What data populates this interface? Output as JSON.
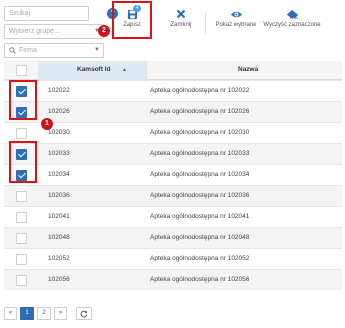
{
  "filters": {
    "search_placeholder": "Szukaj",
    "help_label": "?",
    "group_placeholder": "Wybierz grupę...",
    "firm_placeholder": "Firma"
  },
  "toolbar": {
    "save_label": "Zapisz",
    "save_badge": "4",
    "close_label": "Zamknij",
    "show_selected_label": "Pokaż wybrane",
    "clear_selected_label": "Wyczyść zaznaczone"
  },
  "markers": {
    "first": "1",
    "second": "2"
  },
  "table": {
    "columns": [
      {
        "label": "Kamsoft Id",
        "sort_indicator": "▲"
      },
      {
        "label": "Nazwa"
      }
    ],
    "rows": [
      {
        "id": "102022",
        "name": "Apteka ogólnodostępna nr 102022",
        "checked": true
      },
      {
        "id": "102026",
        "name": "Apteka ogólnodostępna nr 102026",
        "checked": true
      },
      {
        "id": "102030",
        "name": "Apteka ogólnodostępna nr 102030",
        "checked": false
      },
      {
        "id": "102033",
        "name": "Apteka ogólnodostępna nr 102033",
        "checked": true
      },
      {
        "id": "102034",
        "name": "Apteka ogólnodostępna nr 102034",
        "checked": true
      },
      {
        "id": "102036",
        "name": "Apteka ogólnodostępna nr 102036",
        "checked": false
      },
      {
        "id": "102041",
        "name": "Apteka ogólnodostępna nr 102041",
        "checked": false
      },
      {
        "id": "102048",
        "name": "Apteka ogólnodostępna nr 102048",
        "checked": false
      },
      {
        "id": "102052",
        "name": "Apteka ogólnodostępna nr 102052",
        "checked": false
      },
      {
        "id": "102056",
        "name": "Apteka ogólnodostępna nr 102056",
        "checked": false
      }
    ]
  },
  "pagination": {
    "first": "«",
    "pages": [
      "1",
      "2"
    ],
    "current_page": "1",
    "next": "»",
    "refresh_icon": "refresh-icon"
  },
  "colors": {
    "accent": "#2d6fb3",
    "annotation": "#d7141c",
    "badge": "#4aa3e8"
  }
}
